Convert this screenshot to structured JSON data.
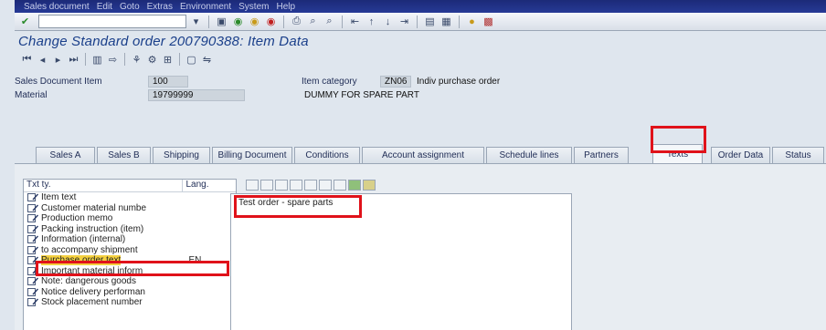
{
  "menu": [
    "Sales document",
    "Edit",
    "Goto",
    "Extras",
    "Environment",
    "System",
    "Help"
  ],
  "toolbar": {
    "command_field_value": "",
    "icons": [
      "enter-icon",
      "save-icon",
      "back-icon",
      "exit-icon",
      "cancel-icon",
      "print-icon",
      "find-icon",
      "find-next-icon",
      "first-page-icon",
      "prev-page-icon",
      "next-page-icon",
      "last-page-icon",
      "create-session-icon",
      "shortcut-icon",
      "help-icon",
      "layout-icon"
    ]
  },
  "title": "Change Standard order 200790388: Item Data",
  "app_toolbar_icons": [
    "first-item-icon",
    "prev-item-icon",
    "next-item-icon",
    "last-item-icon",
    "header-icon",
    "item-icon",
    "document-flow-icon",
    "status-icon",
    "display-icon",
    "config-icon"
  ],
  "header": {
    "item_label": "Sales Document Item",
    "item_value": "100",
    "material_label": "Material",
    "material_value": "19799999",
    "category_label": "Item category",
    "category_code": "ZN06",
    "category_desc": "Indiv purchase order",
    "material_desc": "DUMMY FOR SPARE PART"
  },
  "tabs": [
    "Sales A",
    "Sales B",
    "Shipping",
    "Billing Document",
    "Conditions",
    "Account assignment",
    "Schedule lines",
    "Partners",
    "Texts",
    "Order Data",
    "Status"
  ],
  "active_tab": "Texts",
  "texts": {
    "col_txt_ty": "Txt ty.",
    "col_lang": "Lang.",
    "rows": [
      {
        "name": "Item text",
        "lang": ""
      },
      {
        "name": "Customer material numbe",
        "lang": ""
      },
      {
        "name": "Production memo",
        "lang": ""
      },
      {
        "name": "Packing instruction (item)",
        "lang": ""
      },
      {
        "name": "Information (internal)",
        "lang": ""
      },
      {
        "name": "to accompany shipment",
        "lang": ""
      },
      {
        "name": "Purchase order text",
        "lang": "EN"
      },
      {
        "name": "Important material inform",
        "lang": ""
      },
      {
        "name": "Note: dangerous goods",
        "lang": ""
      },
      {
        "name": "Notice delivery performan",
        "lang": ""
      },
      {
        "name": "Stock placement number",
        "lang": ""
      }
    ],
    "selected_row": 6,
    "editor_content": "Test order - spare parts"
  },
  "colors": {
    "highlight": "#e0121a",
    "title": "#1a3f8a",
    "selection": "#f4d03f"
  }
}
